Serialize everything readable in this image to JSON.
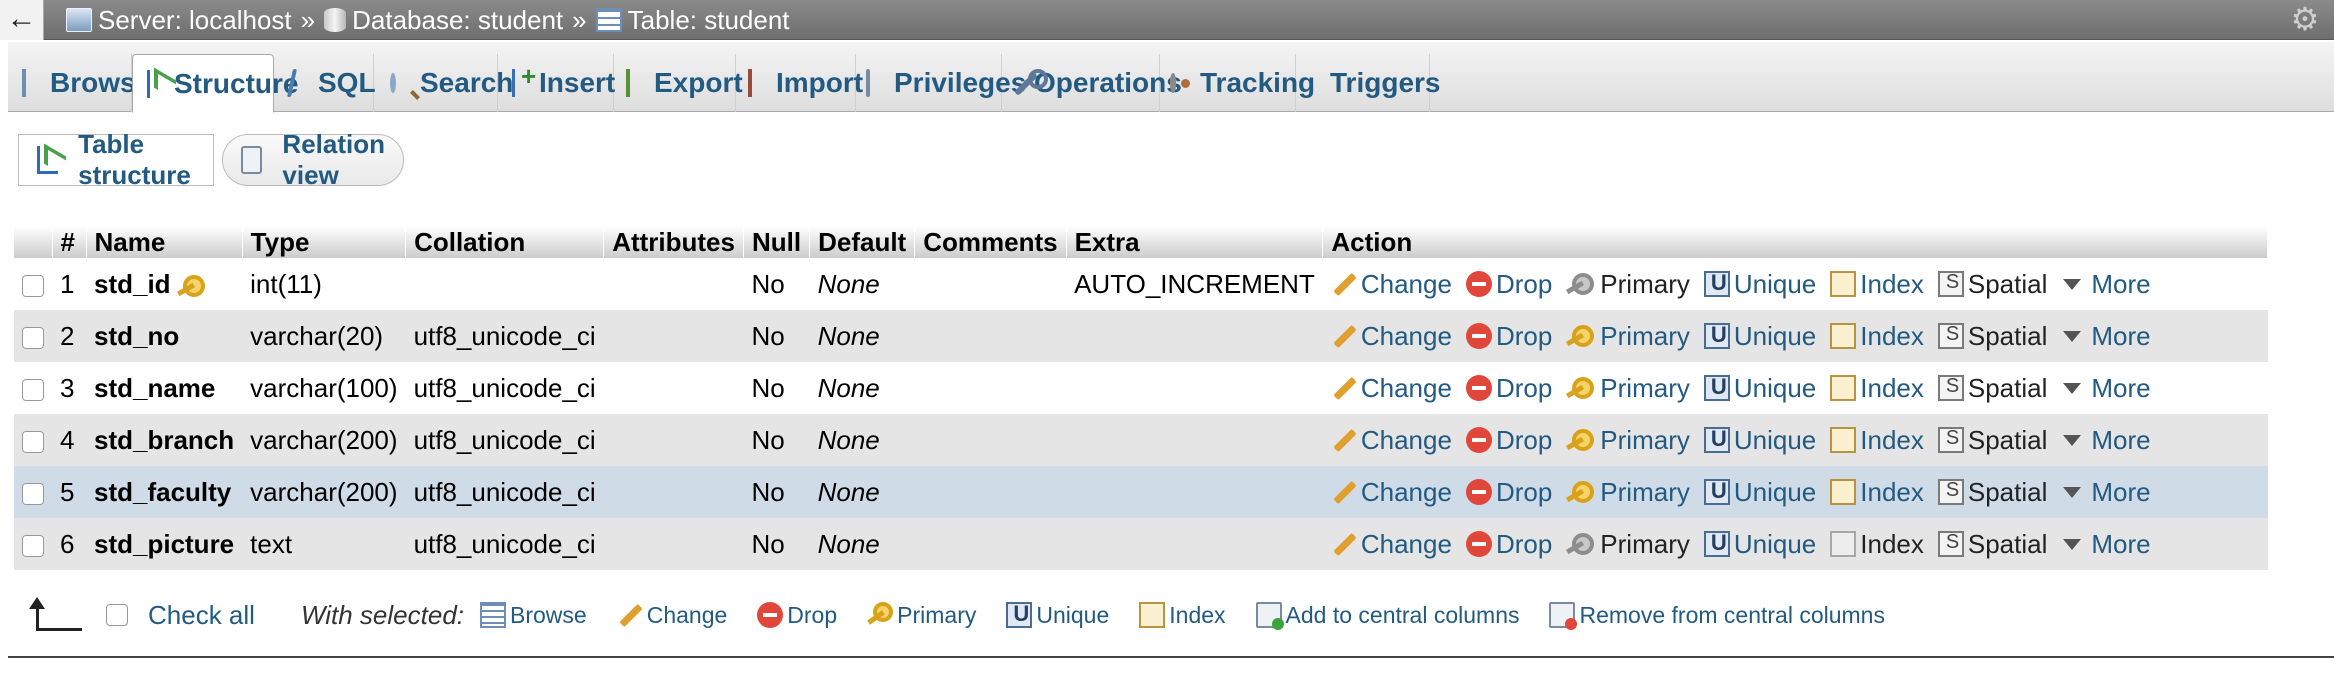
{
  "topbar": {
    "back_glyph": "←",
    "breadcrumb": [
      {
        "label": "Server: localhost",
        "icon": "server-icon"
      },
      {
        "label": "Database: student",
        "icon": "database-icon"
      },
      {
        "label": "Table: student",
        "icon": "table-icon"
      }
    ],
    "separator": "»",
    "settings_icon": "gear-icon"
  },
  "tabs": [
    {
      "label": "Browse",
      "icon": "browse-icon",
      "active": false
    },
    {
      "label": "Structure",
      "icon": "structure-icon",
      "active": true
    },
    {
      "label": "SQL",
      "icon": "sql-icon",
      "active": false
    },
    {
      "label": "Search",
      "icon": "search-icon",
      "active": false
    },
    {
      "label": "Insert",
      "icon": "insert-icon",
      "active": false
    },
    {
      "label": "Export",
      "icon": "export-icon",
      "active": false
    },
    {
      "label": "Import",
      "icon": "import-icon",
      "active": false
    },
    {
      "label": "Privileges",
      "icon": "privileges-icon",
      "active": false
    },
    {
      "label": "Operations",
      "icon": "wrench-icon",
      "active": false
    },
    {
      "label": "Tracking",
      "icon": "eye-icon",
      "active": false
    },
    {
      "label": "Triggers",
      "icon": "triggers-icon",
      "active": false
    }
  ],
  "subtabs": [
    {
      "label": "Table structure",
      "icon": "structure-icon"
    },
    {
      "label": "Relation view",
      "icon": "relation-icon"
    }
  ],
  "table": {
    "headers": [
      "#",
      "Name",
      "Type",
      "Collation",
      "Attributes",
      "Null",
      "Default",
      "Comments",
      "Extra",
      "Action"
    ],
    "rows": [
      {
        "num": "1",
        "name": "std_id",
        "primary_key": true,
        "type": "int(11)",
        "collation": "",
        "attributes": "",
        "null": "No",
        "default": "None",
        "comments": "",
        "extra": "AUTO_INCREMENT",
        "primary_enabled": false,
        "index_enabled": true
      },
      {
        "num": "2",
        "name": "std_no",
        "primary_key": false,
        "type": "varchar(20)",
        "collation": "utf8_unicode_ci",
        "attributes": "",
        "null": "No",
        "default": "None",
        "comments": "",
        "extra": "",
        "primary_enabled": true,
        "index_enabled": true
      },
      {
        "num": "3",
        "name": "std_name",
        "primary_key": false,
        "type": "varchar(100)",
        "collation": "utf8_unicode_ci",
        "attributes": "",
        "null": "No",
        "default": "None",
        "comments": "",
        "extra": "",
        "primary_enabled": true,
        "index_enabled": true
      },
      {
        "num": "4",
        "name": "std_branch",
        "primary_key": false,
        "type": "varchar(200)",
        "collation": "utf8_unicode_ci",
        "attributes": "",
        "null": "No",
        "default": "None",
        "comments": "",
        "extra": "",
        "primary_enabled": true,
        "index_enabled": true
      },
      {
        "num": "5",
        "name": "std_faculty",
        "primary_key": false,
        "type": "varchar(200)",
        "collation": "utf8_unicode_ci",
        "attributes": "",
        "null": "No",
        "default": "None",
        "comments": "",
        "extra": "",
        "primary_enabled": true,
        "index_enabled": true
      },
      {
        "num": "6",
        "name": "std_picture",
        "primary_key": false,
        "type": "text",
        "collation": "utf8_unicode_ci",
        "attributes": "",
        "null": "No",
        "default": "None",
        "comments": "",
        "extra": "",
        "primary_enabled": false,
        "index_enabled": false
      }
    ],
    "actions": {
      "change": "Change",
      "drop": "Drop",
      "primary": "Primary",
      "unique": "Unique",
      "index": "Index",
      "spatial": "Spatial",
      "more": "More"
    },
    "highlighted_row": 5
  },
  "footer": {
    "check_all": "Check all",
    "with_selected": "With selected:",
    "bulk_actions": [
      {
        "label": "Browse",
        "icon": "browse-icon"
      },
      {
        "label": "Change",
        "icon": "pencil-icon"
      },
      {
        "label": "Drop",
        "icon": "drop-icon"
      },
      {
        "label": "Primary",
        "icon": "key-icon"
      },
      {
        "label": "Unique",
        "icon": "unique-icon"
      },
      {
        "label": "Index",
        "icon": "index-icon"
      },
      {
        "label": "Add to central columns",
        "icon": "add-central-icon"
      },
      {
        "label": "Remove from central columns",
        "icon": "remove-central-icon"
      }
    ]
  },
  "colors": {
    "link": "#235a81",
    "row_even": "#e5e5e5",
    "row_highlight": "#cfdce8",
    "topbar": "#7a7a7a"
  }
}
